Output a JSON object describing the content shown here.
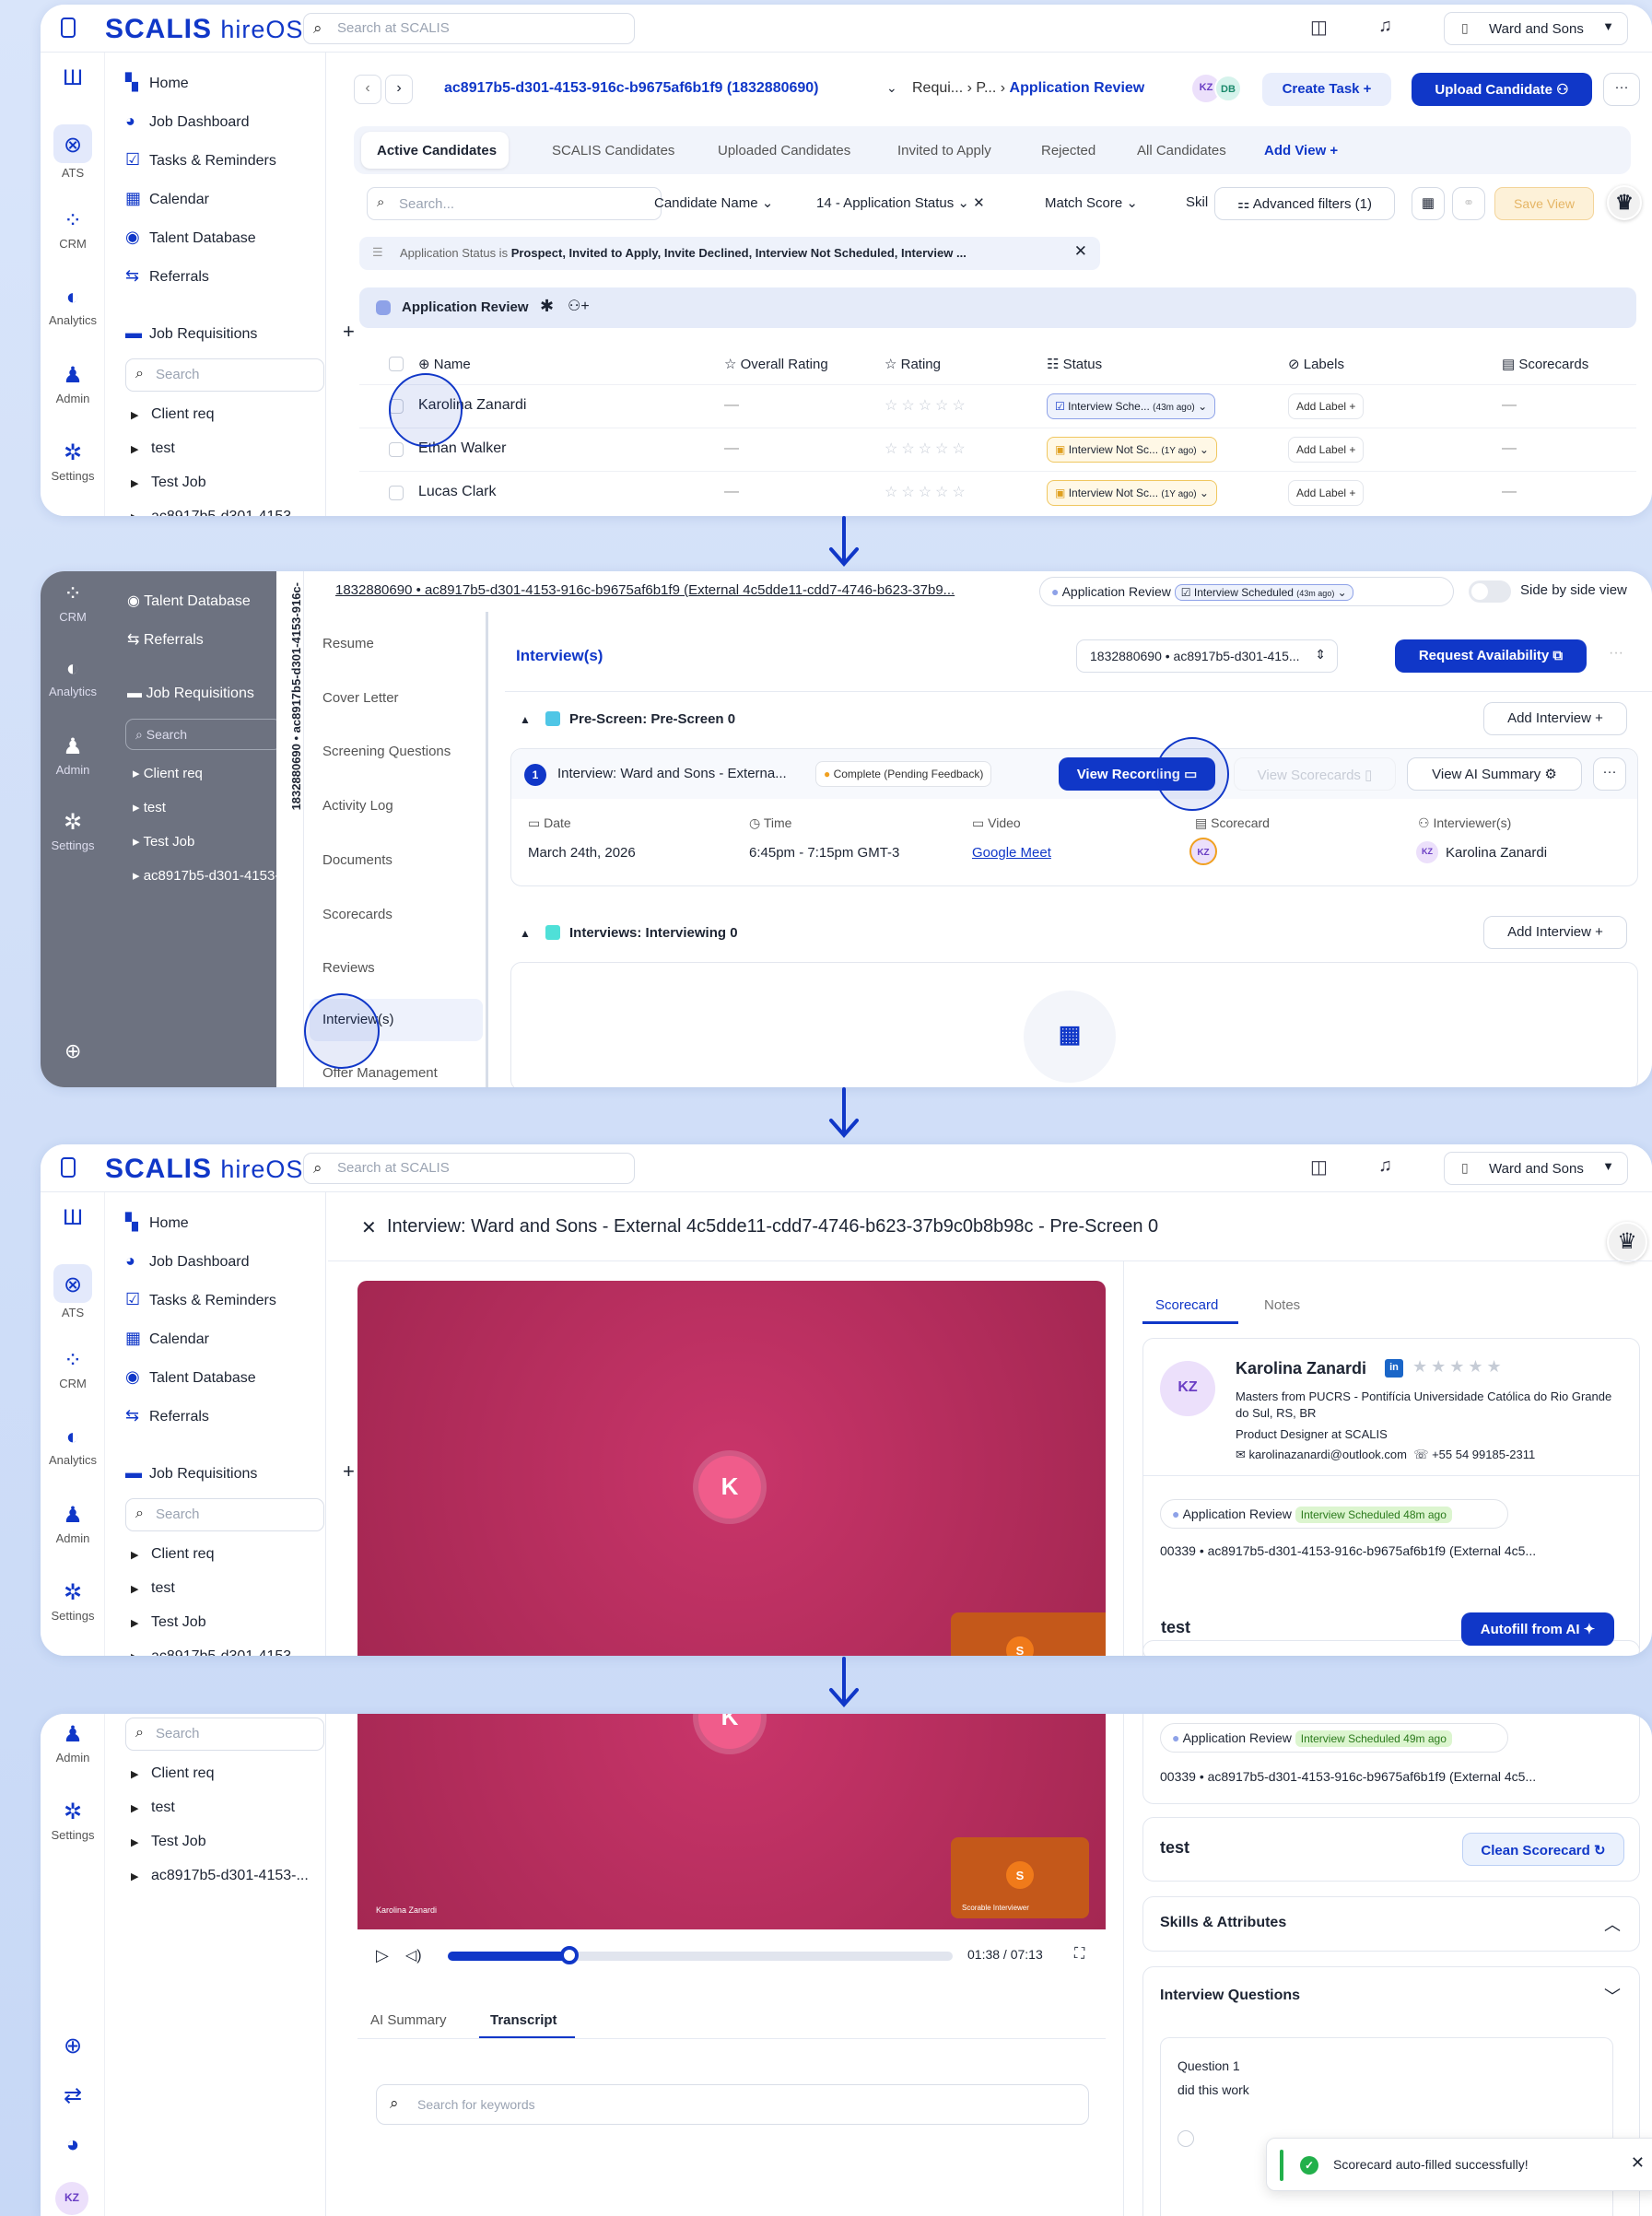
{
  "top": {
    "logo_brand": "SCALIS",
    "logo_product": "hireOS",
    "search_placeholder": "Search at SCALIS",
    "org": "Ward and Sons"
  },
  "rail": {
    "ats": "ATS",
    "crm": "CRM",
    "analytics": "Analytics",
    "admin": "Admin",
    "settings": "Settings"
  },
  "nav": {
    "home": "Home",
    "job_dashboard": "Job Dashboard",
    "tasks": "Tasks & Reminders",
    "calendar": "Calendar",
    "talent_db": "Talent Database",
    "referrals": "Referrals",
    "job_reqs": "Job Requisitions",
    "search": "Search",
    "tree": [
      "Client req",
      "test",
      "Test Job",
      "ac8917b5-d301-4153-..."
    ]
  },
  "p1": {
    "req_id": "ac8917b5-d301-4153-916c-b9675af6b1f9 (1832880690)",
    "crumb_a": "Requi...",
    "crumb_b": "P...",
    "crumb_c": "Application Review",
    "avatar_kz": "KZ",
    "avatar_db": "DB",
    "create_task": "Create Task",
    "upload_candidate": "Upload Candidate",
    "tabs": [
      "Active Candidates",
      "SCALIS Candidates",
      "Uploaded Candidates",
      "Invited to Apply",
      "Rejected",
      "All Candidates"
    ],
    "add_view": "Add View",
    "search_ph": "Search...",
    "f_name": "Candidate Name",
    "f_status": "14 - Application Status",
    "f_match": "Match Score",
    "f_skill": "Skil",
    "f_adv": "Advanced filters (1)",
    "save_view": "Save View",
    "filter_label": "Application Status is",
    "filter_value": "Prospect, Invited to Apply, Invite Declined, Interview Not Scheduled, Interview ...",
    "stage": "Application Review",
    "cols": [
      "Name",
      "Overall Rating",
      "Rating",
      "Status",
      "Labels",
      "Scorecards"
    ],
    "rows": [
      {
        "name": "Karolina Zanardi",
        "overall": "—",
        "status": "Interview Sche...",
        "age": "(43m ago)",
        "label": "Add Label",
        "score": "—"
      },
      {
        "name": "Ethan Walker",
        "overall": "—",
        "status": "Interview Not Sc...",
        "age": "(1Y ago)",
        "label": "Add Label",
        "score": "—"
      },
      {
        "name": "Lucas Clark",
        "overall": "—",
        "status": "Interview Not Sc...",
        "age": "(1Y ago)",
        "label": "Add Label",
        "score": "—"
      }
    ]
  },
  "p2": {
    "header": "1832880690 • ac8917b5-d301-4153-916c-b9675af6b1f9 (External 4c5dde11-cdd7-4746-b623-37b9...",
    "stage": "Application Review",
    "status": "Interview Scheduled",
    "status_age": "(43m ago)",
    "side_by_side": "Side by side view",
    "vertical_id": "1832880690 • ac8917b5-d301-4153-916c-",
    "menu": [
      "Resume",
      "Cover Letter",
      "Screening Questions",
      "Activity Log",
      "Documents",
      "Scorecards",
      "Reviews",
      "Interview(s)",
      "Offer Management"
    ],
    "title": "Interview(s)",
    "selector": "1832880690 • ac8917b5-d301-415...",
    "request_avail": "Request Availability",
    "section1": "Pre-Screen: Pre-Screen 0",
    "add_interview": "Add Interview",
    "interview_num": "1",
    "interview_name": "Interview: Ward and Sons - Externa...",
    "complete": "Complete (Pending Feedback)",
    "view_recording": "View Recording",
    "view_scorecards": "View Scorecards",
    "view_ai": "View AI Summary",
    "h_date": "Date",
    "h_time": "Time",
    "h_video": "Video",
    "h_scorecard": "Scorecard",
    "h_interviewers": "Interviewer(s)",
    "date": "March 24th, 2026",
    "time": "6:45pm - 7:15pm GMT-3",
    "video": "Google Meet",
    "interviewer": "Karolina Zanardi",
    "kz": "KZ",
    "section2": "Interviews: Interviewing 0"
  },
  "p3": {
    "title": "Interview: Ward and Sons - External 4c5dde11-cdd7-4746-b623-37b9c0b8b98c - Pre-Screen 0",
    "tab_scorecard": "Scorecard",
    "tab_notes": "Notes",
    "cand_initials": "KZ",
    "cand_name": "Karolina Zanardi",
    "linkedin": "in",
    "edu": "Masters from PUCRS - Pontifícia Universidade Católica do Rio Grande do Sul, RS, BR",
    "role": "Product Designer at SCALIS",
    "email": "karolinazanardi@outlook.com",
    "phone": "+55 54 99185-2311",
    "stage": "Application Review",
    "status": "Interview Scheduled 48m ago",
    "req": "00339 • ac8917b5-d301-4153-916c-b9675af6b1f9 (External 4c5...",
    "card": "test",
    "autofill": "Autofill from AI",
    "video_k": "K",
    "video_s": "S"
  },
  "p4": {
    "stage": "Application Review",
    "status": "Interview Scheduled 49m ago",
    "req": "00339 • ac8917b5-d301-4153-916c-b9675af6b1f9 (External 4c5...",
    "card": "test",
    "clean": "Clean Scorecard",
    "skills": "Skills & Attributes",
    "questions": "Interview Questions",
    "q_label": "Question 1",
    "q_text": "did this work",
    "video_name": "Karolina Zanardi",
    "video_s_name": "Scorable Interviewer",
    "time": "01:38 / 07:13",
    "progress": 0.24,
    "tab_ai": "AI Summary",
    "tab_transcript": "Transcript",
    "kw_ph": "Search for keywords",
    "toast": "Scorecard auto-filled successfully!",
    "user": "KZ"
  },
  "colors": {
    "brand": "#1037c8",
    "video": "#c0305e",
    "pip": "#d0661a"
  }
}
